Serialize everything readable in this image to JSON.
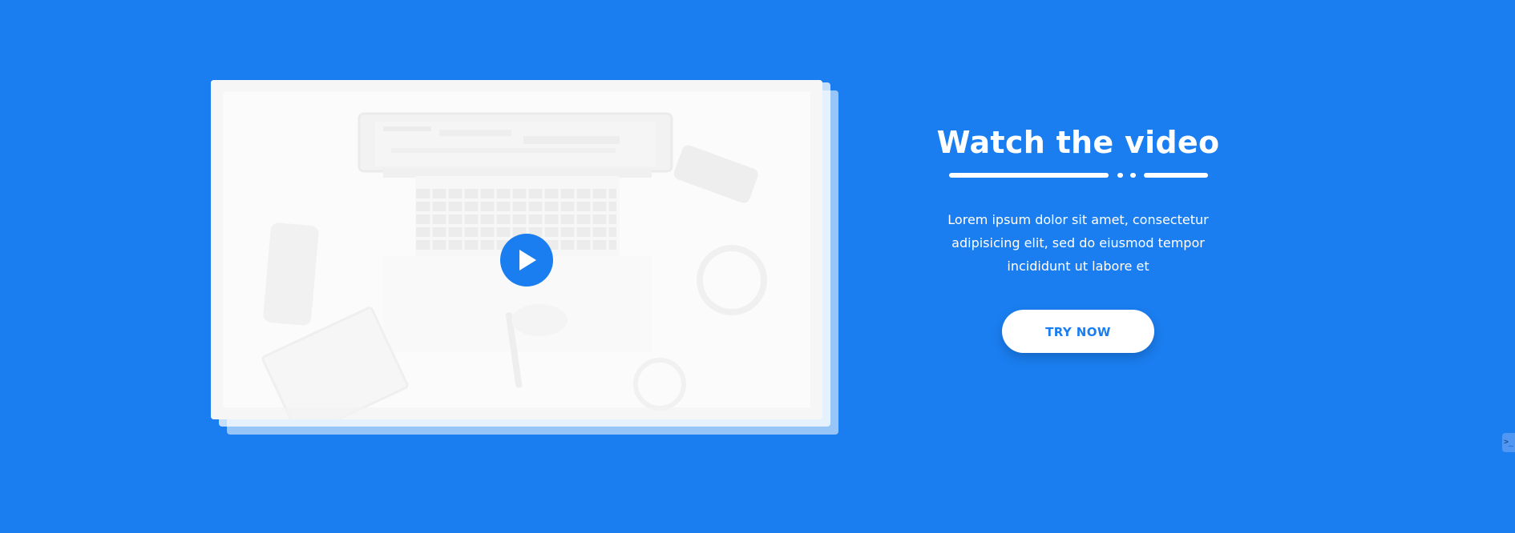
{
  "colors": {
    "background": "#1a7ef0",
    "card": "#fbfbfb",
    "button_bg": "#ffffff",
    "button_text": "#1a7ef0"
  },
  "video": {
    "play_icon": "play-icon",
    "thumbnail_icon": "laptop-desk-scene"
  },
  "hero": {
    "title": "Watch the video",
    "description": "Lorem ipsum dolor sit amet, consectetur adipisicing elit, sed do eiusmod tempor incididunt ut labore et",
    "cta_label": "TRY NOW"
  },
  "edge_widget": {
    "icon": "terminal-icon",
    "label": ">_"
  }
}
